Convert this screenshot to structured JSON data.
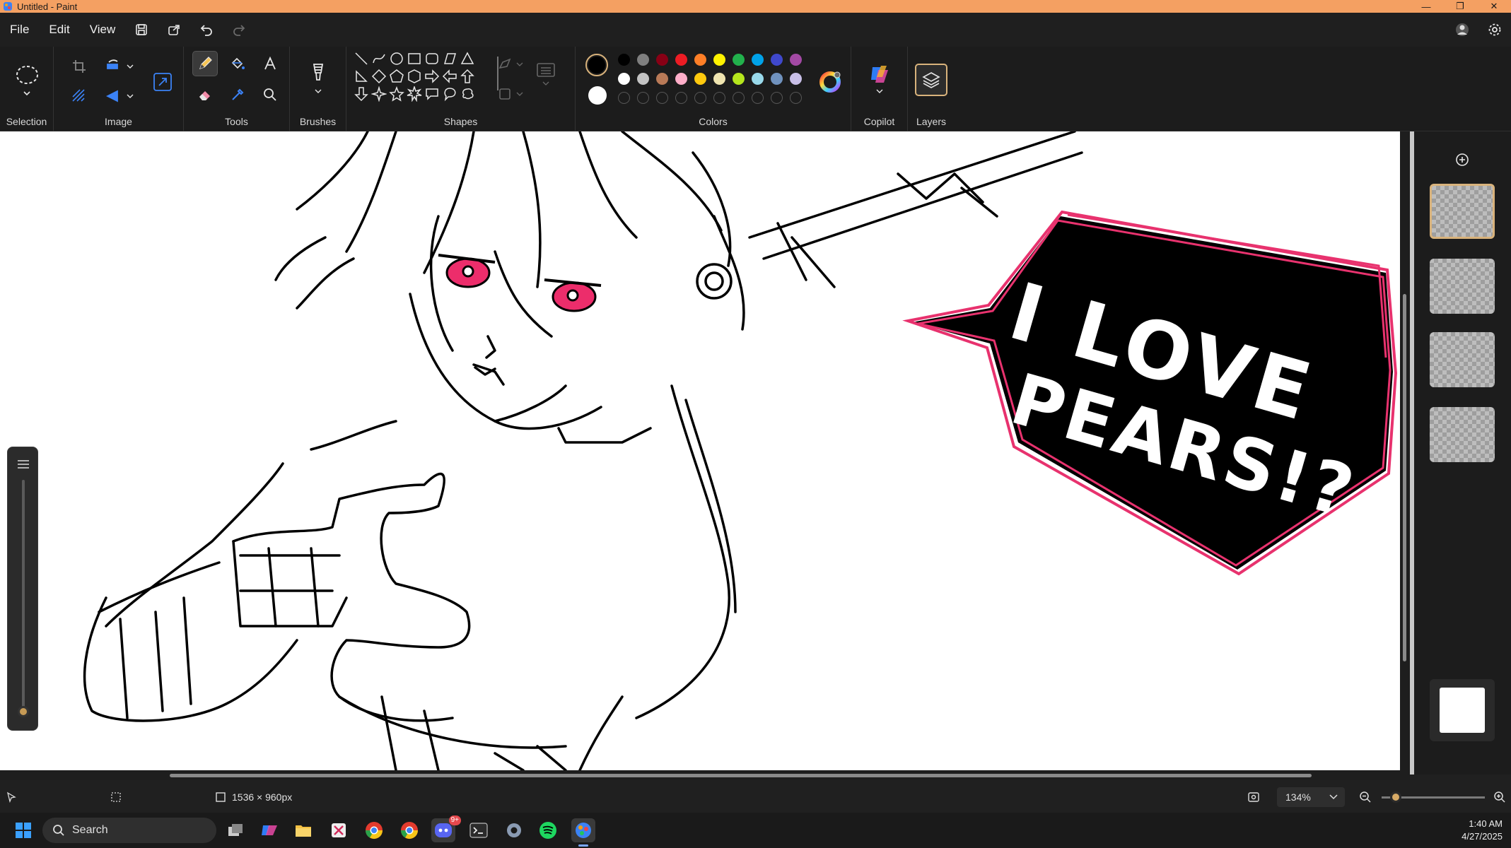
{
  "window": {
    "title": "Untitled - Paint"
  },
  "menu": {
    "file": "File",
    "edit": "Edit",
    "view": "View"
  },
  "ribbon": {
    "groups": {
      "selection": "Selection",
      "image": "Image",
      "tools": "Tools",
      "brushes": "Brushes",
      "shapes": "Shapes",
      "colors": "Colors",
      "copilot": "Copilot",
      "layers": "Layers"
    },
    "active_tool": "pencil",
    "primary_color": "#000000",
    "secondary_color": "#ffffff",
    "palette_row1": [
      "#000000",
      "#7f7f7f",
      "#880015",
      "#ed1c24",
      "#ff7f27",
      "#fff200",
      "#22b14c",
      "#00a2e8",
      "#3f48cc",
      "#a349a4"
    ],
    "palette_row2": [
      "#ffffff",
      "#c3c3c3",
      "#b97a57",
      "#ffaec9",
      "#ffc90e",
      "#efe4b0",
      "#b5e61d",
      "#99d9ea",
      "#7092be",
      "#c8bfe7"
    ]
  },
  "canvas": {
    "speech_text_line1": "I LOVE",
    "speech_text_line2": "PEARS!?",
    "bubble_stroke": "#e8326e",
    "eye_color": "#ec2d6b"
  },
  "status": {
    "canvas_size": "1536 × 960px",
    "zoom": "134%",
    "zoom_fraction": 0.14
  },
  "taskbar": {
    "search_placeholder": "Search",
    "time": "1:40 AM",
    "date": "4/27/2025",
    "discord_badge": "9+"
  }
}
